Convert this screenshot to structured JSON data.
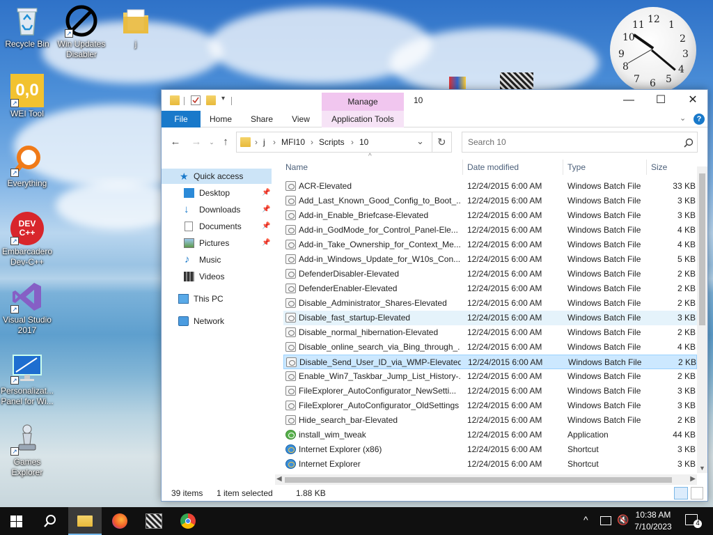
{
  "desktop": {
    "icons": [
      {
        "id": "recycle-bin",
        "label": "Recycle Bin"
      },
      {
        "id": "win-updates-disabler",
        "label": "Win Updates Disabler"
      },
      {
        "id": "folder-j",
        "label": "j"
      },
      {
        "id": "wei-tool",
        "label": "WEI Tool",
        "glyph": "0,0"
      },
      {
        "id": "everything",
        "label": "Everything"
      },
      {
        "id": "dev-cpp",
        "label": "Embarcadero Dev-C++",
        "glyph": "DEV C++"
      },
      {
        "id": "visual-studio",
        "label": "Visual Studio 2017"
      },
      {
        "id": "personalization-panel",
        "label": "Personalizat... Panel for Wi..."
      },
      {
        "id": "games-explorer",
        "label": "Games Explorer"
      }
    ],
    "clock_numbers": [
      "12",
      "1",
      "2",
      "3",
      "4",
      "5",
      "6",
      "7",
      "8",
      "9",
      "10",
      "11"
    ]
  },
  "explorer": {
    "title": "10",
    "manage_label": "Manage",
    "ribbon_tabs": [
      "File",
      "Home",
      "Share",
      "View",
      "Application Tools"
    ],
    "address_path": [
      "j",
      "MFI10",
      "Scripts",
      "10"
    ],
    "search_placeholder": "Search 10",
    "nav_items": [
      {
        "label": "Quick access",
        "pinned": false
      },
      {
        "label": "Desktop",
        "pinned": true
      },
      {
        "label": "Downloads",
        "pinned": true
      },
      {
        "label": "Documents",
        "pinned": true
      },
      {
        "label": "Pictures",
        "pinned": true
      },
      {
        "label": "Music",
        "pinned": false
      },
      {
        "label": "Videos",
        "pinned": false
      },
      {
        "label": "This PC",
        "pinned": false
      },
      {
        "label": "Network",
        "pinned": false
      }
    ],
    "columns": [
      "Name",
      "Date modified",
      "Type",
      "Size"
    ],
    "files": [
      {
        "name": "ACR-Elevated",
        "date": "12/24/2015 6:00 AM",
        "type": "Windows Batch File",
        "size": "33 KB"
      },
      {
        "name": "Add_Last_Known_Good_Config_to_Boot_...",
        "date": "12/24/2015 6:00 AM",
        "type": "Windows Batch File",
        "size": "3 KB"
      },
      {
        "name": "Add-in_Enable_Briefcase-Elevated",
        "date": "12/24/2015 6:00 AM",
        "type": "Windows Batch File",
        "size": "3 KB"
      },
      {
        "name": "Add-in_GodMode_for_Control_Panel-Ele...",
        "date": "12/24/2015 6:00 AM",
        "type": "Windows Batch File",
        "size": "4 KB"
      },
      {
        "name": "Add-in_Take_Ownership_for_Context_Me...",
        "date": "12/24/2015 6:00 AM",
        "type": "Windows Batch File",
        "size": "4 KB"
      },
      {
        "name": "Add-in_Windows_Update_for_W10s_Con...",
        "date": "12/24/2015 6:00 AM",
        "type": "Windows Batch File",
        "size": "5 KB"
      },
      {
        "name": "DefenderDisabler-Elevated",
        "date": "12/24/2015 6:00 AM",
        "type": "Windows Batch File",
        "size": "2 KB"
      },
      {
        "name": "DefenderEnabler-Elevated",
        "date": "12/24/2015 6:00 AM",
        "type": "Windows Batch File",
        "size": "2 KB"
      },
      {
        "name": "Disable_Administrator_Shares-Elevated",
        "date": "12/24/2015 6:00 AM",
        "type": "Windows Batch File",
        "size": "2 KB"
      },
      {
        "name": "Disable_fast_startup-Elevated",
        "date": "12/24/2015 6:00 AM",
        "type": "Windows Batch File",
        "size": "3 KB"
      },
      {
        "name": "Disable_normal_hibernation-Elevated",
        "date": "12/24/2015 6:00 AM",
        "type": "Windows Batch File",
        "size": "2 KB"
      },
      {
        "name": "Disable_online_search_via_Bing_through_...",
        "date": "12/24/2015 6:00 AM",
        "type": "Windows Batch File",
        "size": "4 KB"
      },
      {
        "name": "Disable_Send_User_ID_via_WMP-Elevated",
        "date": "12/24/2015 6:00 AM",
        "type": "Windows Batch File",
        "size": "2 KB"
      },
      {
        "name": "Enable_Win7_Taskbar_Jump_List_History-...",
        "date": "12/24/2015 6:00 AM",
        "type": "Windows Batch File",
        "size": "2 KB"
      },
      {
        "name": "FileExplorer_AutoConfigurator_NewSetti...",
        "date": "12/24/2015 6:00 AM",
        "type": "Windows Batch File",
        "size": "3 KB"
      },
      {
        "name": "FileExplorer_AutoConfigurator_OldSettings",
        "date": "12/24/2015 6:00 AM",
        "type": "Windows Batch File",
        "size": "3 KB"
      },
      {
        "name": "Hide_search_bar-Elevated",
        "date": "12/24/2015 6:00 AM",
        "type": "Windows Batch File",
        "size": "2 KB"
      },
      {
        "name": "install_wim_tweak",
        "date": "12/24/2015 6:00 AM",
        "type": "Application",
        "size": "44 KB"
      },
      {
        "name": "Internet Explorer (x86)",
        "date": "12/24/2015 6:00 AM",
        "type": "Shortcut",
        "size": "3 KB"
      },
      {
        "name": "Internet Explorer",
        "date": "12/24/2015 6:00 AM",
        "type": "Shortcut",
        "size": "3 KB"
      }
    ],
    "hovered_row": 9,
    "selected_row": 12,
    "status": {
      "items": "39 items",
      "selected": "1 item selected",
      "size": "1.88 KB"
    }
  },
  "taskbar": {
    "apps": [
      "start",
      "search",
      "file-explorer",
      "firefox",
      "app",
      "chrome"
    ],
    "time": "10:38 AM",
    "date": "7/10/2023",
    "notification_count": "4"
  },
  "colors": {
    "file_tab": "#1979ca",
    "manage_tab": "#f1c6ef",
    "selection": "#cce8ff",
    "taskbar": "#101010"
  }
}
